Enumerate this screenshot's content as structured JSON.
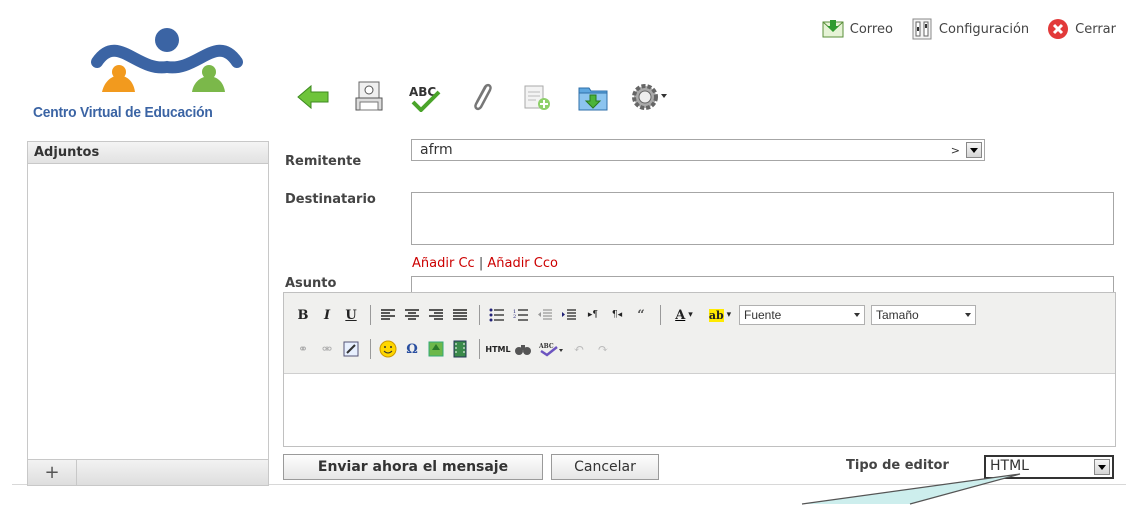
{
  "top": {
    "mail_label": "Correo",
    "settings_label": "Configuración",
    "close_label": "Cerrar"
  },
  "logo": {
    "text": "Centro Virtual de Educación"
  },
  "sidebar": {
    "title": "Adjuntos",
    "add_label": "+"
  },
  "form": {
    "sender_label": "Remitente",
    "sender_value": "afrm",
    "sender_suffix": ">",
    "recipient_label": "Destinatario",
    "recipient_value": "",
    "add_cc": "Añadir Cc",
    "link_sep": "|",
    "add_bcc": "Añadir Cco",
    "subject_label": "Asunto"
  },
  "editor": {
    "font_select": "Fuente",
    "size_select": "Tamaño",
    "html_btn": "HTML"
  },
  "actions": {
    "send_label": "Enviar ahora el mensaje",
    "cancel_label": "Cancelar",
    "editor_type_label": "Tipo de editor",
    "editor_type_value": "HTML"
  },
  "colors": {
    "accent_red": "#cc0000",
    "logo_blue": "#3b64a4",
    "green_arrow": "#5cb82e"
  }
}
